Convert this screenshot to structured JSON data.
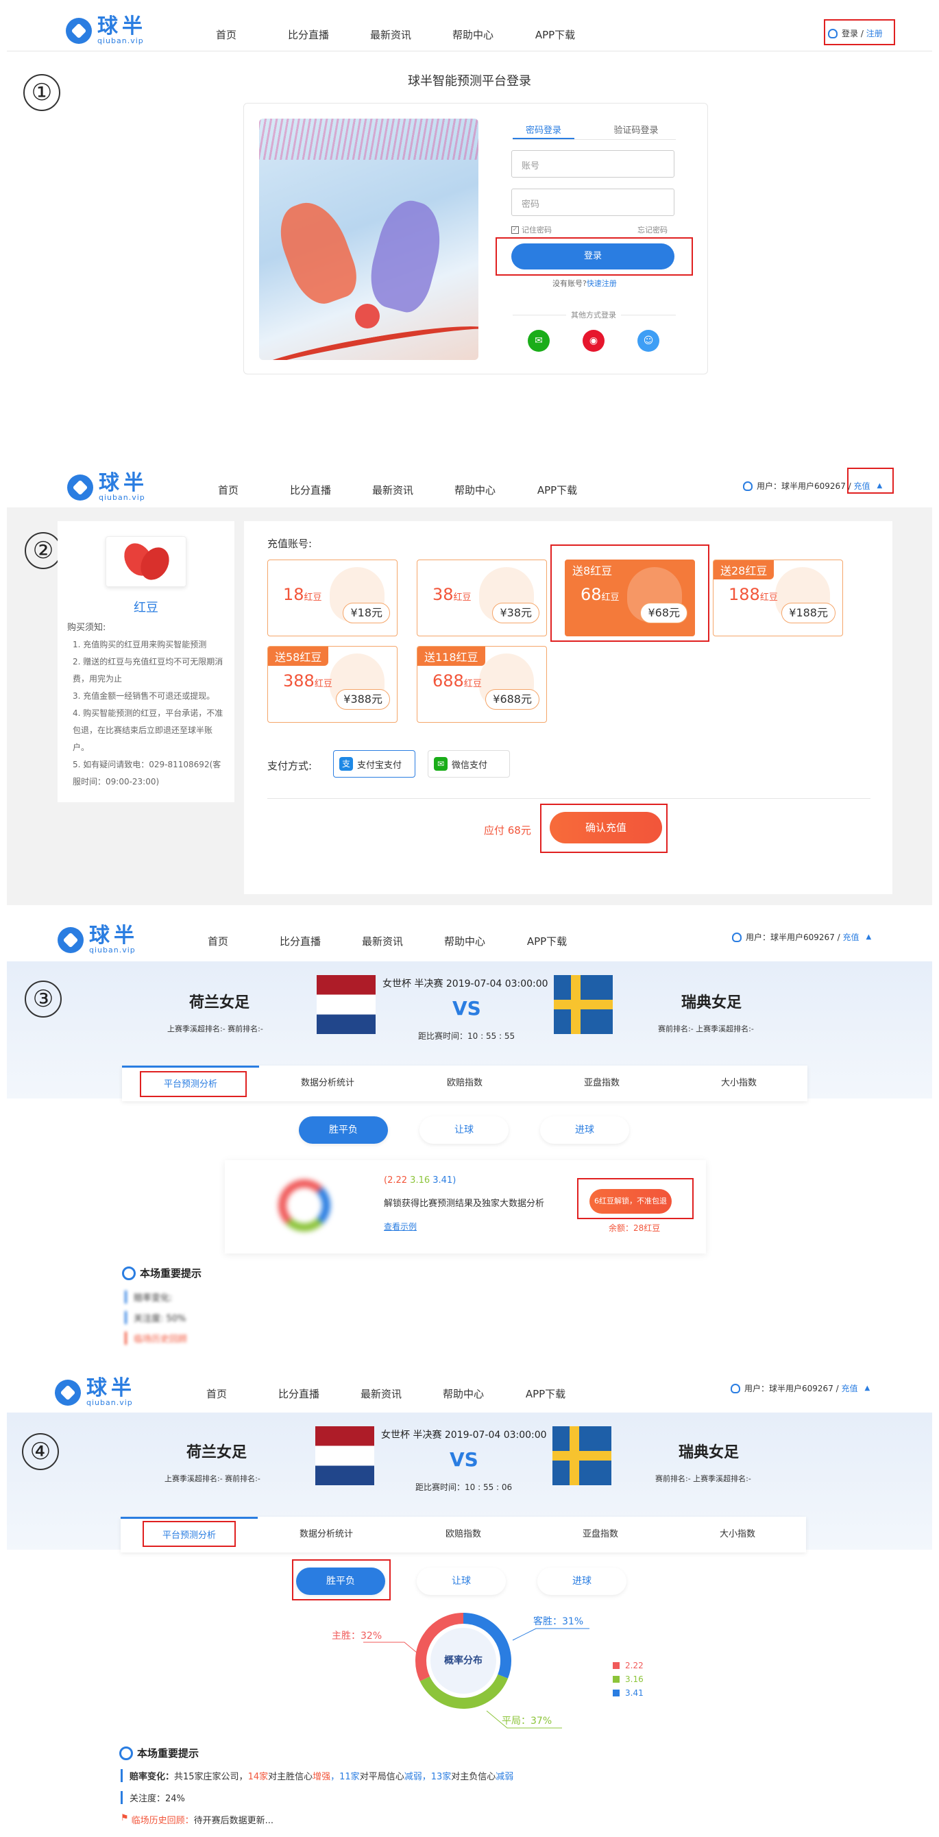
{
  "brand": {
    "name": "球半",
    "domain": "qiuban.vip"
  },
  "menu": [
    "首页",
    "比分直播",
    "最新资讯",
    "帮助中心",
    "APP下载"
  ],
  "markers": [
    "①",
    "②",
    "③",
    "④"
  ],
  "s1": {
    "login": "登录",
    "sep": "/",
    "register": "注册",
    "title": "球半智能预测平台登录",
    "tab_pwd": "密码登录",
    "tab_code": "验证码登录",
    "account_ph": "账号",
    "password_ph": "密码",
    "remember": "记住密码",
    "forgot": "忘记密码",
    "login_btn": "登录",
    "no_account": "没有账号?",
    "quick_reg": "快速注册",
    "other": "其他方式登录",
    "icons": [
      "wechat-icon",
      "weibo-icon",
      "qq-icon"
    ],
    "colors": {
      "wechat": "#1aad19",
      "weibo": "#e6162d",
      "qq": "#3e9ef5"
    }
  },
  "user": {
    "label": "用户：",
    "name": "球半用户609267",
    "sep": "/",
    "recharge": "充值"
  },
  "s2": {
    "product": "红豆",
    "notice_title": "购买须知:",
    "notices": [
      "1. 充值购买的红豆用来购买智能预测",
      "2. 赠送的红豆与充值红豆均不可无限期消费，用完为止",
      "3. 充值金额一经销售不可退还或提现。",
      "4. 购买智能预测的红豆，平台承诺，不准包退，在比赛结束后立即退还至球半账户。",
      "5. 如有疑问请致电：029-81108692(客服时间：09:00-23:00)"
    ],
    "acct_label": "充值账号:",
    "packages": [
      {
        "gift": "",
        "amount": "18",
        "unit": "红豆",
        "price": "¥18元"
      },
      {
        "gift": "",
        "amount": "38",
        "unit": "红豆",
        "price": "¥38元"
      },
      {
        "gift": "送8红豆",
        "amount": "68",
        "unit": "红豆",
        "price": "¥68元"
      },
      {
        "gift": "送28红豆",
        "amount": "188",
        "unit": "红豆",
        "price": "¥188元"
      },
      {
        "gift": "送58红豆",
        "amount": "388",
        "unit": "红豆",
        "price": "¥388元"
      },
      {
        "gift": "送118红豆",
        "amount": "688",
        "unit": "红豆",
        "price": "¥688元"
      }
    ],
    "pay_label": "支付方式:",
    "alipay": "支付宝支付",
    "wxpay": "微信支付",
    "due": "应付 68元",
    "confirm": "确认充值"
  },
  "match": {
    "home": "荷兰女足",
    "away": "瑞典女足",
    "home_rank": "上赛季溪超排名:-  赛前排名:-",
    "away_rank": "赛前排名:-  上赛季溪超排名:-",
    "title": "女世杯 半决赛 2019-07-04 03:00:00",
    "vs": "VS",
    "countdown3": "距比赛时间：10 : 55 : 55",
    "countdown4": "距比赛时间：10 : 55 : 06",
    "tabs": [
      "平台预测分析",
      "数据分析统计",
      "欧赔指数",
      "亚盘指数",
      "大小指数"
    ],
    "pills": [
      "胜平负",
      "让球",
      "进球"
    ]
  },
  "s3": {
    "odds": [
      "(2.22",
      "3.16",
      "3.41)"
    ],
    "unlock_text": "解锁获得比赛预测结果及独家大数据分析",
    "example": "查看示例",
    "unlock_btn": "6红豆解锁，不准包退",
    "balance": "余额：28红豆",
    "tips_title": "本场重要提示",
    "tips": [
      "赔率变化:",
      "关注度:  50%",
      "临场历史回顾"
    ]
  },
  "s4": {
    "center": "概率分布",
    "labels": {
      "home": "主胜：32%",
      "away": "客胜：31%",
      "draw": "平局：37%"
    },
    "legend": [
      "2.22",
      "3.16",
      "3.41"
    ],
    "colors": [
      "#f05a5a",
      "#8cc43a",
      "#2a7de1"
    ],
    "tips_title": "本场重要提示",
    "t1_label": "赔率变化：",
    "t1_a": "共15家庄家公司，",
    "t1_b": "14家",
    "t1_c": "对主胜信心",
    "t1_d": "增强",
    "t1_e": "，11家",
    "t1_f": "对平局信心",
    "t1_g": "减弱",
    "t1_h": "，13家",
    "t1_i": "对主负信心",
    "t1_j": "减弱",
    "t2": "关注度：24%",
    "t3_label": "临场历史回顾：",
    "t3": "待开赛后数据更新..."
  },
  "chart_data": {
    "type": "pie",
    "title": "概率分布",
    "categories": [
      "主胜",
      "客胜",
      "平局"
    ],
    "values": [
      32,
      31,
      37
    ],
    "odds": [
      2.22,
      3.16,
      3.41
    ]
  }
}
